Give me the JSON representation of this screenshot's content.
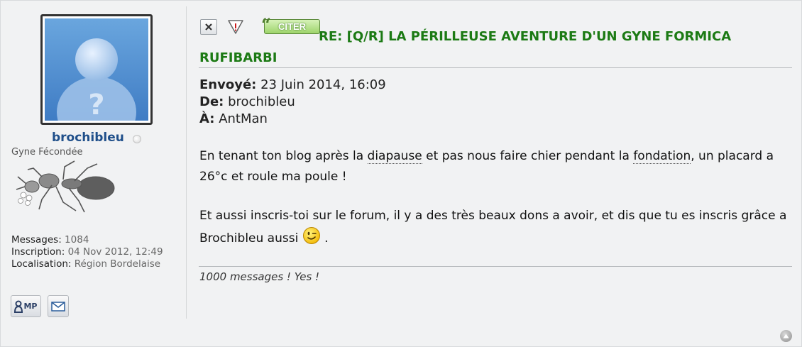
{
  "profile": {
    "username": "brochibleu",
    "rank": "Gyne Fécondée",
    "messages_label": "Messages:",
    "messages_value": "1084",
    "inscription_label": "Inscription:",
    "inscription_value": "04 Nov 2012, 12:49",
    "localisation_label": "Localisation:",
    "localisation_value": "Région Bordelaise",
    "pm_button": "MP"
  },
  "post": {
    "quote_button": "CITER",
    "title": "RE: [Q/R] LA PÉRILLEUSE AVENTURE D'UN GYNE FORMICA RUFIBARBI",
    "sent_label": "Envoyé:",
    "sent_value": "23 Juin 2014, 16:09",
    "from_label": "De:",
    "from_value": "brochibleu",
    "to_label": "À:",
    "to_value": "AntMan",
    "p1_a": "En tenant ton blog après la ",
    "p1_link1": "diapause",
    "p1_b": " et pas nous faire chier pendant la ",
    "p1_link2": "fondation",
    "p1_c": ", un placard a 26°c et roule ma poule !",
    "p2_a": "Et aussi inscris-toi sur le forum, il y a des très beaux dons a avoir, et dis que tu es inscris grâce a Brochibleu aussi ",
    "p2_b": " .",
    "signature": "1000 messages ! Yes !"
  },
  "icons": {
    "delete": "close-icon",
    "report": "warning-icon",
    "pm": "user-icon",
    "email": "envelope-icon",
    "top": "arrow-up-icon",
    "smiley": "wink-smiley-icon"
  },
  "colors": {
    "title": "#1c7a14",
    "username": "#1f4f8a",
    "background": "#f1f2f3"
  }
}
